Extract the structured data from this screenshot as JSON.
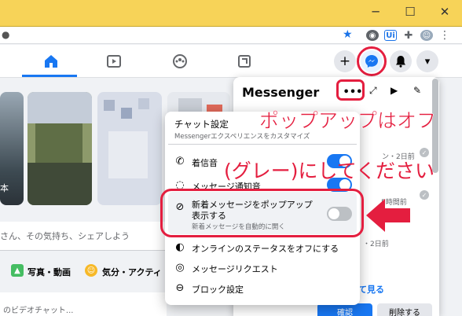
{
  "browser": {
    "window_controls": {
      "minimize": "─",
      "maximize": "☐",
      "close": "✕"
    },
    "extensions": [
      "star-icon",
      "profile-sync-icon",
      "ui-extension-icon",
      "puzzle-icon",
      "avatar-icon",
      "kebab-menu-icon"
    ],
    "ui_ext_label": "Ui"
  },
  "fb_header": {
    "create_btn": "+",
    "notifications": "",
    "account": "▾"
  },
  "composer": {
    "placeholder_text": "さん、その気持ち、シェアしよう",
    "photo_video": "写真・動画",
    "feeling_activity": "気分・アクティ",
    "bottom_snippet": "のビデオチャット..."
  },
  "stories": {
    "left_caption": "本"
  },
  "messenger": {
    "title": "Messenger",
    "conversations": [
      {
        "meta": "ン・2日前"
      },
      {
        "meta": "5時間前"
      },
      {
        "meta": "・2日前"
      },
      {
        "meta": "・2日前"
      }
    ],
    "see_all": "て見る",
    "bottom_left": "確認",
    "bottom_right": "削除する"
  },
  "chat_menu": {
    "header_title": "チャット設定",
    "header_sub": "Messengerエクスペリエンスをカスタマイズ",
    "items": [
      {
        "label": "着信音",
        "toggle": true
      },
      {
        "label": "メッセージ通知音",
        "toggle": true
      },
      {
        "label": "新着メッセージをポップアップ表示する",
        "label_line1": "新着メッセージをポップアップ",
        "label_line2": "表示する",
        "sub": "新着メッセージを自動的に開く",
        "toggle": false
      },
      {
        "label": "オンラインのステータスをオフにする"
      },
      {
        "label": "メッセージリクエスト"
      },
      {
        "label": "ブロック設定"
      }
    ]
  },
  "annotations": {
    "line1": "ポップアップはオフ",
    "line2": "(グレー)にしてください",
    "arrow": "⬅"
  },
  "colors": {
    "accent": "#1877f2",
    "annotation": "#e41e3f",
    "chrome_title": "#f7d358"
  }
}
